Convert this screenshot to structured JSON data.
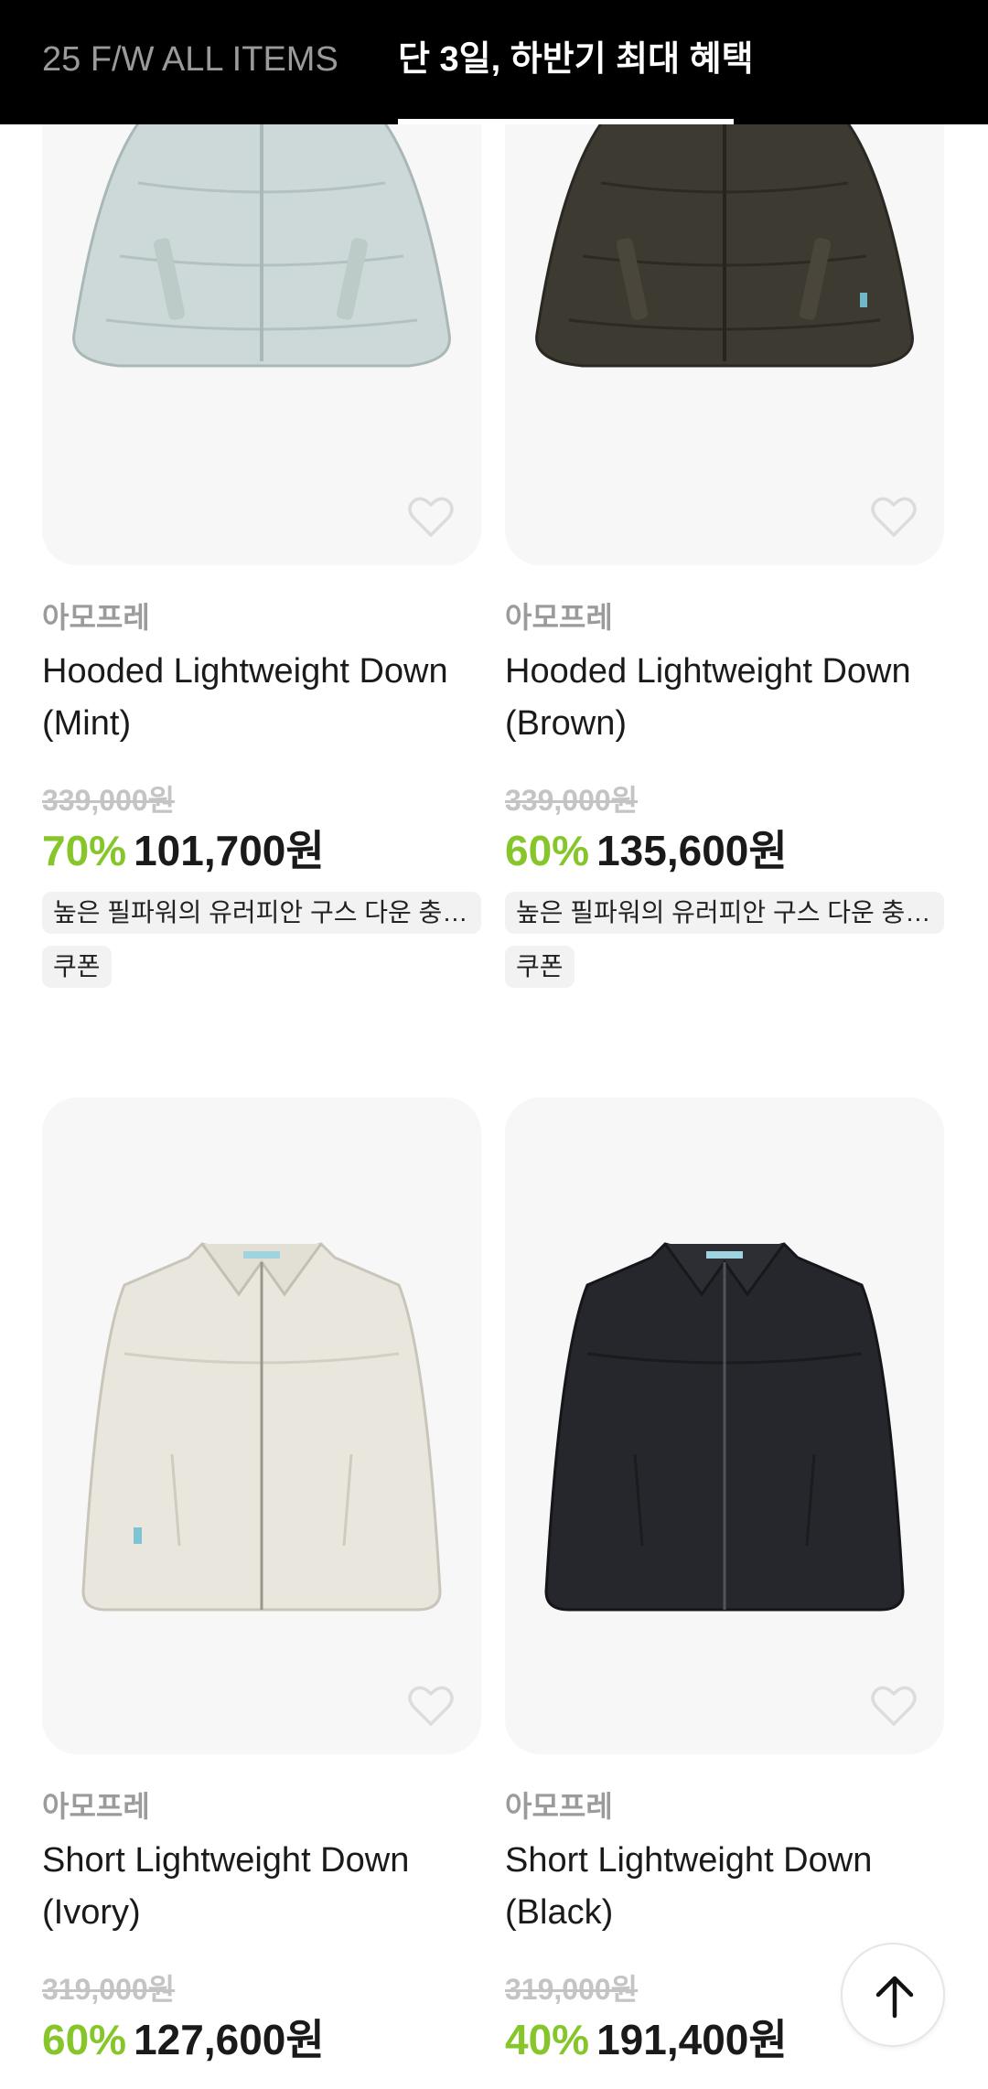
{
  "tabs": [
    {
      "label": "25 F/W ALL ITEMS",
      "active": false
    },
    {
      "label": "단 3일, 하반기 최대 혜택",
      "active": true
    }
  ],
  "products": [
    {
      "brand": "아모프레",
      "name": "Hooded Lightweight Down (Mint)",
      "original_price": "339,000원",
      "discount": "70%",
      "sale_price": "101,700원",
      "description": "높은 필파워의 유러피안 구스 다운 충전재를 사용한 경량 후드 다운",
      "badge": "쿠폰",
      "color": "#cdd9d8",
      "liked": false
    },
    {
      "brand": "아모프레",
      "name": "Hooded Lightweight Down (Brown)",
      "original_price": "339,000원",
      "discount": "60%",
      "sale_price": "135,600원",
      "description": "높은 필파워의 유러피안 구스 다운 충전재를 사용한 경량 후드 다운",
      "badge": "쿠폰",
      "color": "#3d3a31",
      "liked": false
    },
    {
      "brand": "아모프레",
      "name": "Short Lightweight Down (Ivory)",
      "original_price": "319,000원",
      "discount": "60%",
      "sale_price": "127,600원",
      "color": "#e9e6dd",
      "liked": false
    },
    {
      "brand": "아모프레",
      "name": "Short Lightweight Down (Black)",
      "original_price": "319,000원",
      "discount": "40%",
      "sale_price": "191,400원",
      "color": "#25272c",
      "liked": false
    }
  ],
  "icons": {
    "wishlist": "heart-outline-icon",
    "scroll_top": "arrow-up-icon"
  },
  "colors": {
    "discount": "#86c62b",
    "header_bg": "#000000"
  }
}
